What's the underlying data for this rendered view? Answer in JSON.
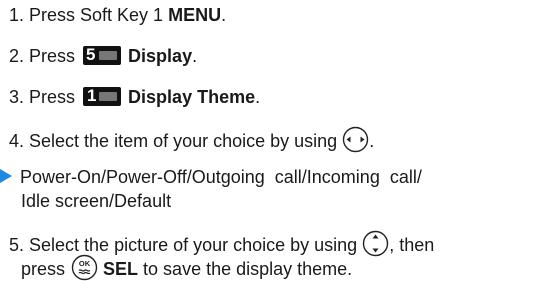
{
  "steps": {
    "step1": {
      "prefix": "1. Press Soft Key 1 ",
      "bold": "MENU",
      "suffix": "."
    },
    "step2": {
      "prefix": "2. Press ",
      "key_number": "5",
      "bold": "Display",
      "suffix": "."
    },
    "step3": {
      "prefix": "3. Press ",
      "key_number": "1",
      "bold": "Display Theme",
      "suffix": "."
    },
    "step4": {
      "text": "4. Select the item of your choice by using",
      "suffix": "."
    },
    "options": {
      "line1": "Power-On/Power-Off/Outgoing call/Incoming call/",
      "line2": "Idle screen/Default"
    },
    "step5": {
      "line1_prefix": "5. Select the picture of your choice by using",
      "line1_suffix": ", then",
      "line2_prefix": "press",
      "bold": "SEL",
      "line2_suffix": " to save the display theme."
    }
  },
  "icons": {
    "bullet": "right-triangle-bullet-icon",
    "nav_left_right": "left-right-navigation-key-icon",
    "nav_up_down": "up-down-navigation-key-icon",
    "ok_key": "ok-key-icon",
    "ok_key_label": "OK"
  },
  "colors": {
    "bullet": "#1b8be0",
    "text": "#1a1a1a",
    "key": "#111111"
  }
}
